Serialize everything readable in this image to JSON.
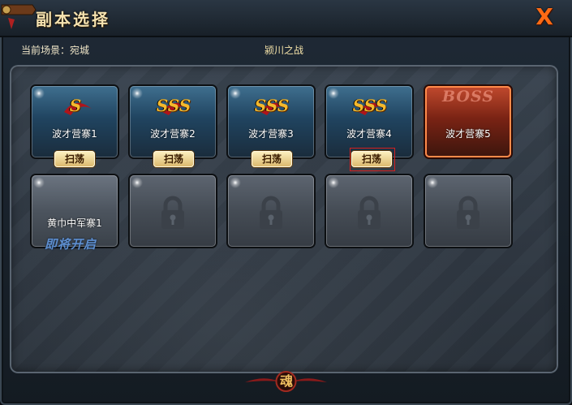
{
  "window": {
    "title": "副本选择",
    "close_symbol": "X",
    "accent_color": "#ff6a14"
  },
  "info": {
    "current_scene": "当前场景：宛城",
    "battle_name": "颍川之战"
  },
  "stages": [
    {
      "label": "波才营寨1",
      "grade": "S",
      "type": "cleared",
      "sweep": "扫荡"
    },
    {
      "label": "波才营寨2",
      "grade": "SSS",
      "type": "cleared",
      "sweep": "扫荡"
    },
    {
      "label": "波才营寨3",
      "grade": "SSS",
      "type": "cleared",
      "sweep": "扫荡"
    },
    {
      "label": "波才营寨4",
      "grade": "SSS",
      "type": "cleared",
      "sweep": "扫荡",
      "highlighted": true
    },
    {
      "label": "波才营寨5",
      "grade": "BOSS",
      "type": "boss"
    },
    {
      "label": "黄巾中军寨1",
      "type": "unlocked",
      "note": "即将开启"
    },
    {
      "type": "locked",
      "icon": "lock-icon"
    },
    {
      "type": "locked",
      "icon": "lock-icon"
    },
    {
      "type": "locked",
      "icon": "lock-icon"
    },
    {
      "type": "locked",
      "icon": "lock-icon"
    }
  ],
  "footer": {
    "glyph": "魂"
  }
}
